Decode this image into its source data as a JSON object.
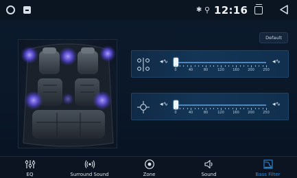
{
  "status_bar": {
    "time": "12:16",
    "bluetooth_icon": "bluetooth-icon",
    "location_icon": "location-icon"
  },
  "default_button": {
    "label": "Default"
  },
  "sliders": [
    {
      "icon": "speaker-balance-icon",
      "value": 0,
      "max": 250,
      "ticks": [
        "0",
        "40",
        "80",
        "120",
        "160",
        "200",
        "250"
      ]
    },
    {
      "icon": "crosshair-icon",
      "value": 0,
      "max": 250,
      "ticks": [
        "0",
        "40",
        "80",
        "120",
        "160",
        "200",
        "250"
      ]
    }
  ],
  "bottom_nav": [
    {
      "label": "EQ",
      "icon": "equalizer-icon",
      "active": false
    },
    {
      "label": "Surround Sound",
      "icon": "surround-sound-icon",
      "active": false
    },
    {
      "label": "Zone",
      "icon": "zone-icon",
      "active": false
    },
    {
      "label": "Sound",
      "icon": "sound-icon",
      "active": false
    },
    {
      "label": "Bass Filter",
      "icon": "bass-filter-icon",
      "active": true
    }
  ],
  "colors": {
    "accent": "#2c8de0",
    "speaker_glow": "#6e58ff",
    "background": "#0a1728"
  }
}
